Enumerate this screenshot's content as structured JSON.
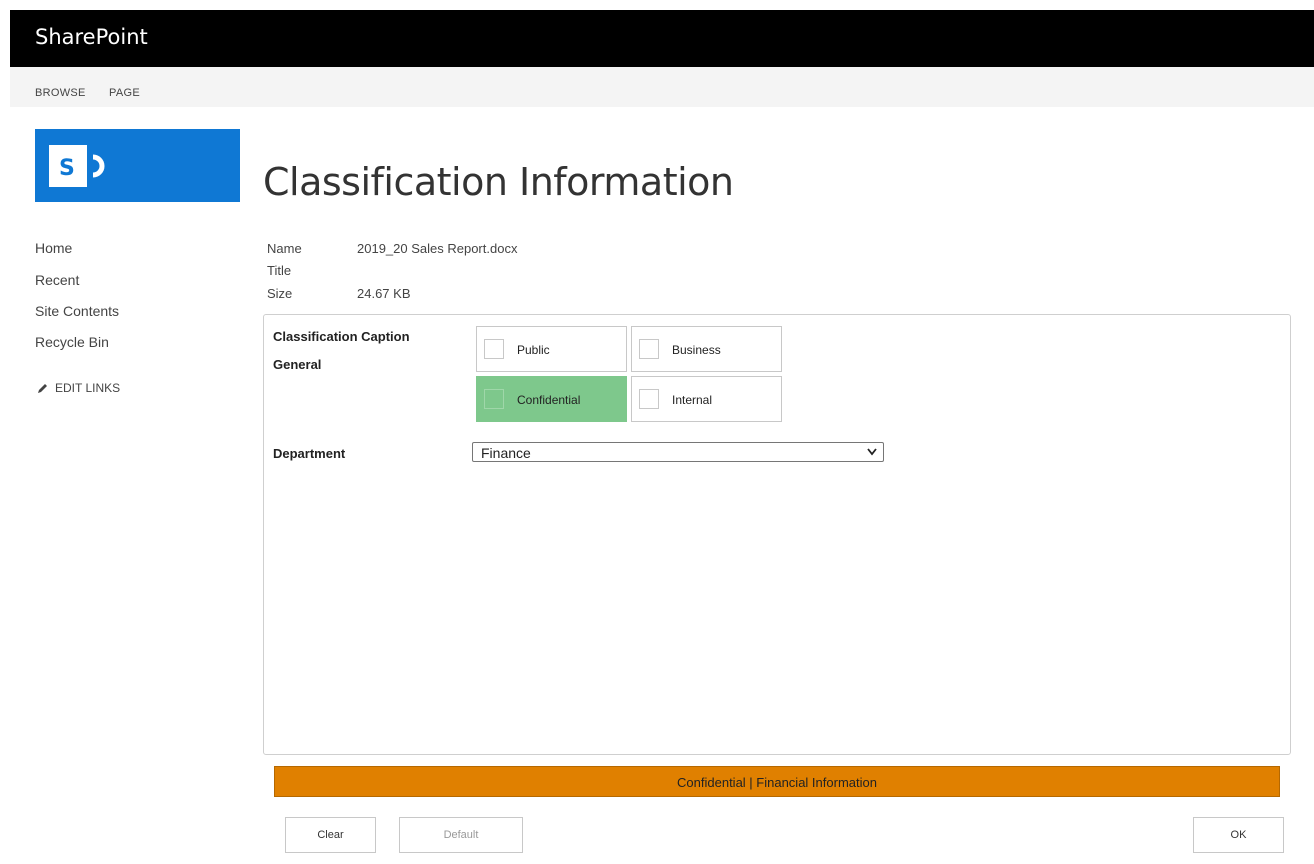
{
  "app": {
    "brand": "SharePoint"
  },
  "ribbon": {
    "tabs": [
      "BROWSE",
      "PAGE"
    ]
  },
  "nav": {
    "items": [
      "Home",
      "Recent",
      "Site Contents",
      "Recycle Bin"
    ],
    "edit_links": "EDIT LINKS"
  },
  "page": {
    "title": "Classification Information"
  },
  "file": {
    "name_label": "Name",
    "name_value": "2019_20 Sales Report.docx",
    "title_label": "Title",
    "title_value": "",
    "size_label": "Size",
    "size_value": "24.67 KB"
  },
  "form": {
    "caption_label": "Classification Caption",
    "caption_value": "General",
    "options": [
      {
        "label": "Public",
        "selected": false
      },
      {
        "label": "Business",
        "selected": false
      },
      {
        "label": "Confidential",
        "selected": true
      },
      {
        "label": "Internal",
        "selected": false
      }
    ],
    "department_label": "Department",
    "department_value": "Finance"
  },
  "banner": {
    "text": "Confidential | Financial Information",
    "color": "#e08000"
  },
  "buttons": {
    "clear": "Clear",
    "default": "Default",
    "ok": "OK"
  },
  "colors": {
    "selected": "#7ec88c",
    "logo": "#0f78d4"
  }
}
